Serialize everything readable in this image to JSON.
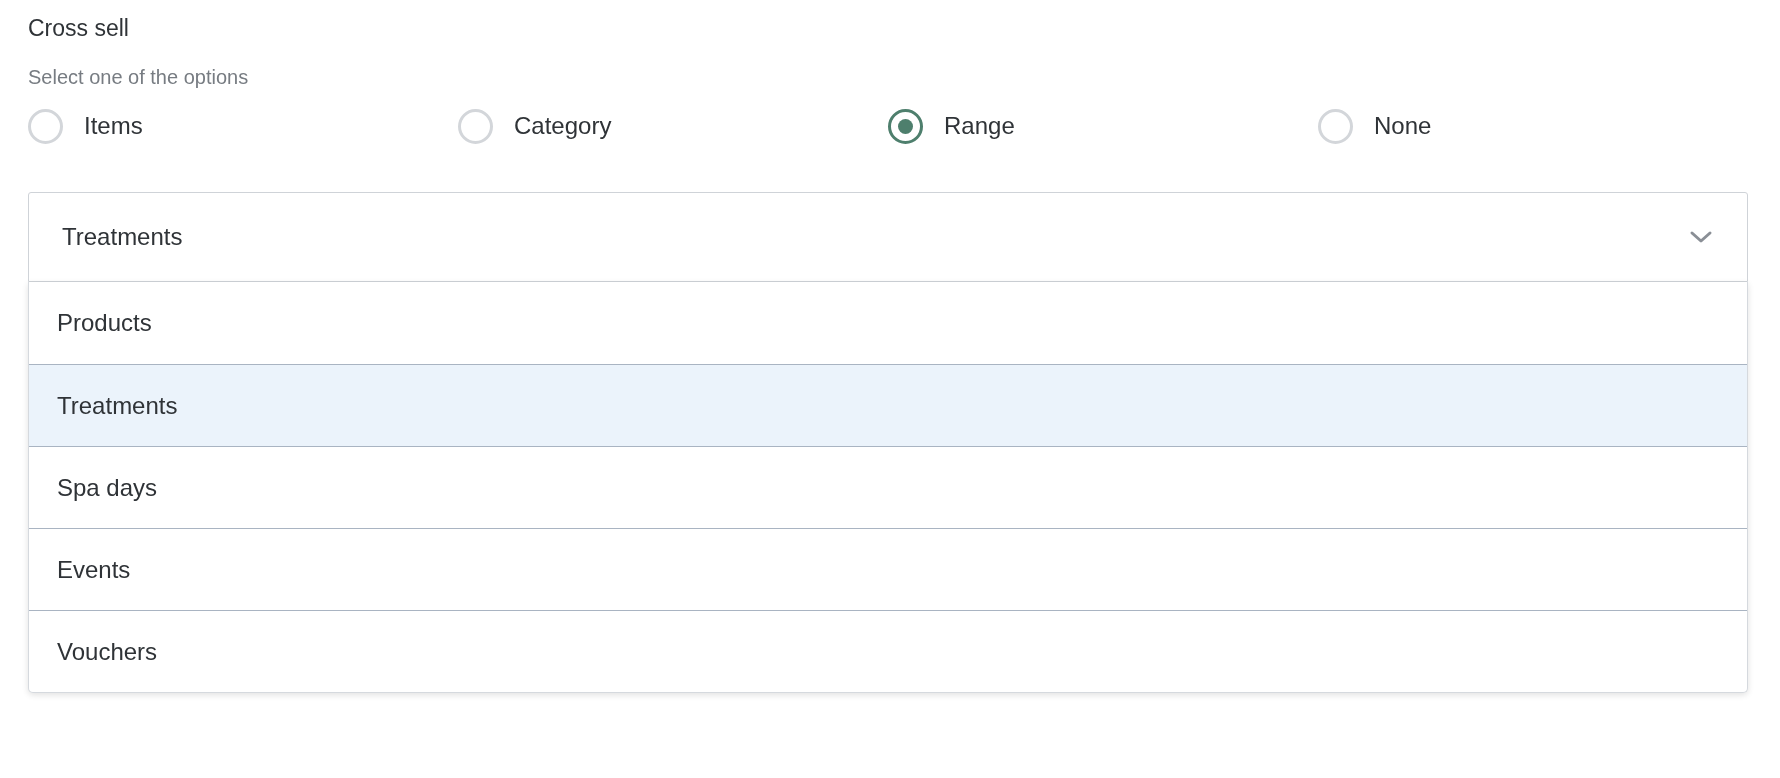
{
  "heading": "Cross sell",
  "hint": "Select one of the options",
  "options": [
    {
      "label": "Items",
      "selected": false
    },
    {
      "label": "Category",
      "selected": false
    },
    {
      "label": "Range",
      "selected": true
    },
    {
      "label": "None",
      "selected": false
    }
  ],
  "dropdown": {
    "value": "Treatments",
    "expanded": true,
    "items": [
      {
        "label": "Products",
        "selected": false
      },
      {
        "label": "Treatments",
        "selected": true
      },
      {
        "label": "Spa days",
        "selected": false
      },
      {
        "label": "Events",
        "selected": false
      },
      {
        "label": "Vouchers",
        "selected": false
      }
    ]
  }
}
